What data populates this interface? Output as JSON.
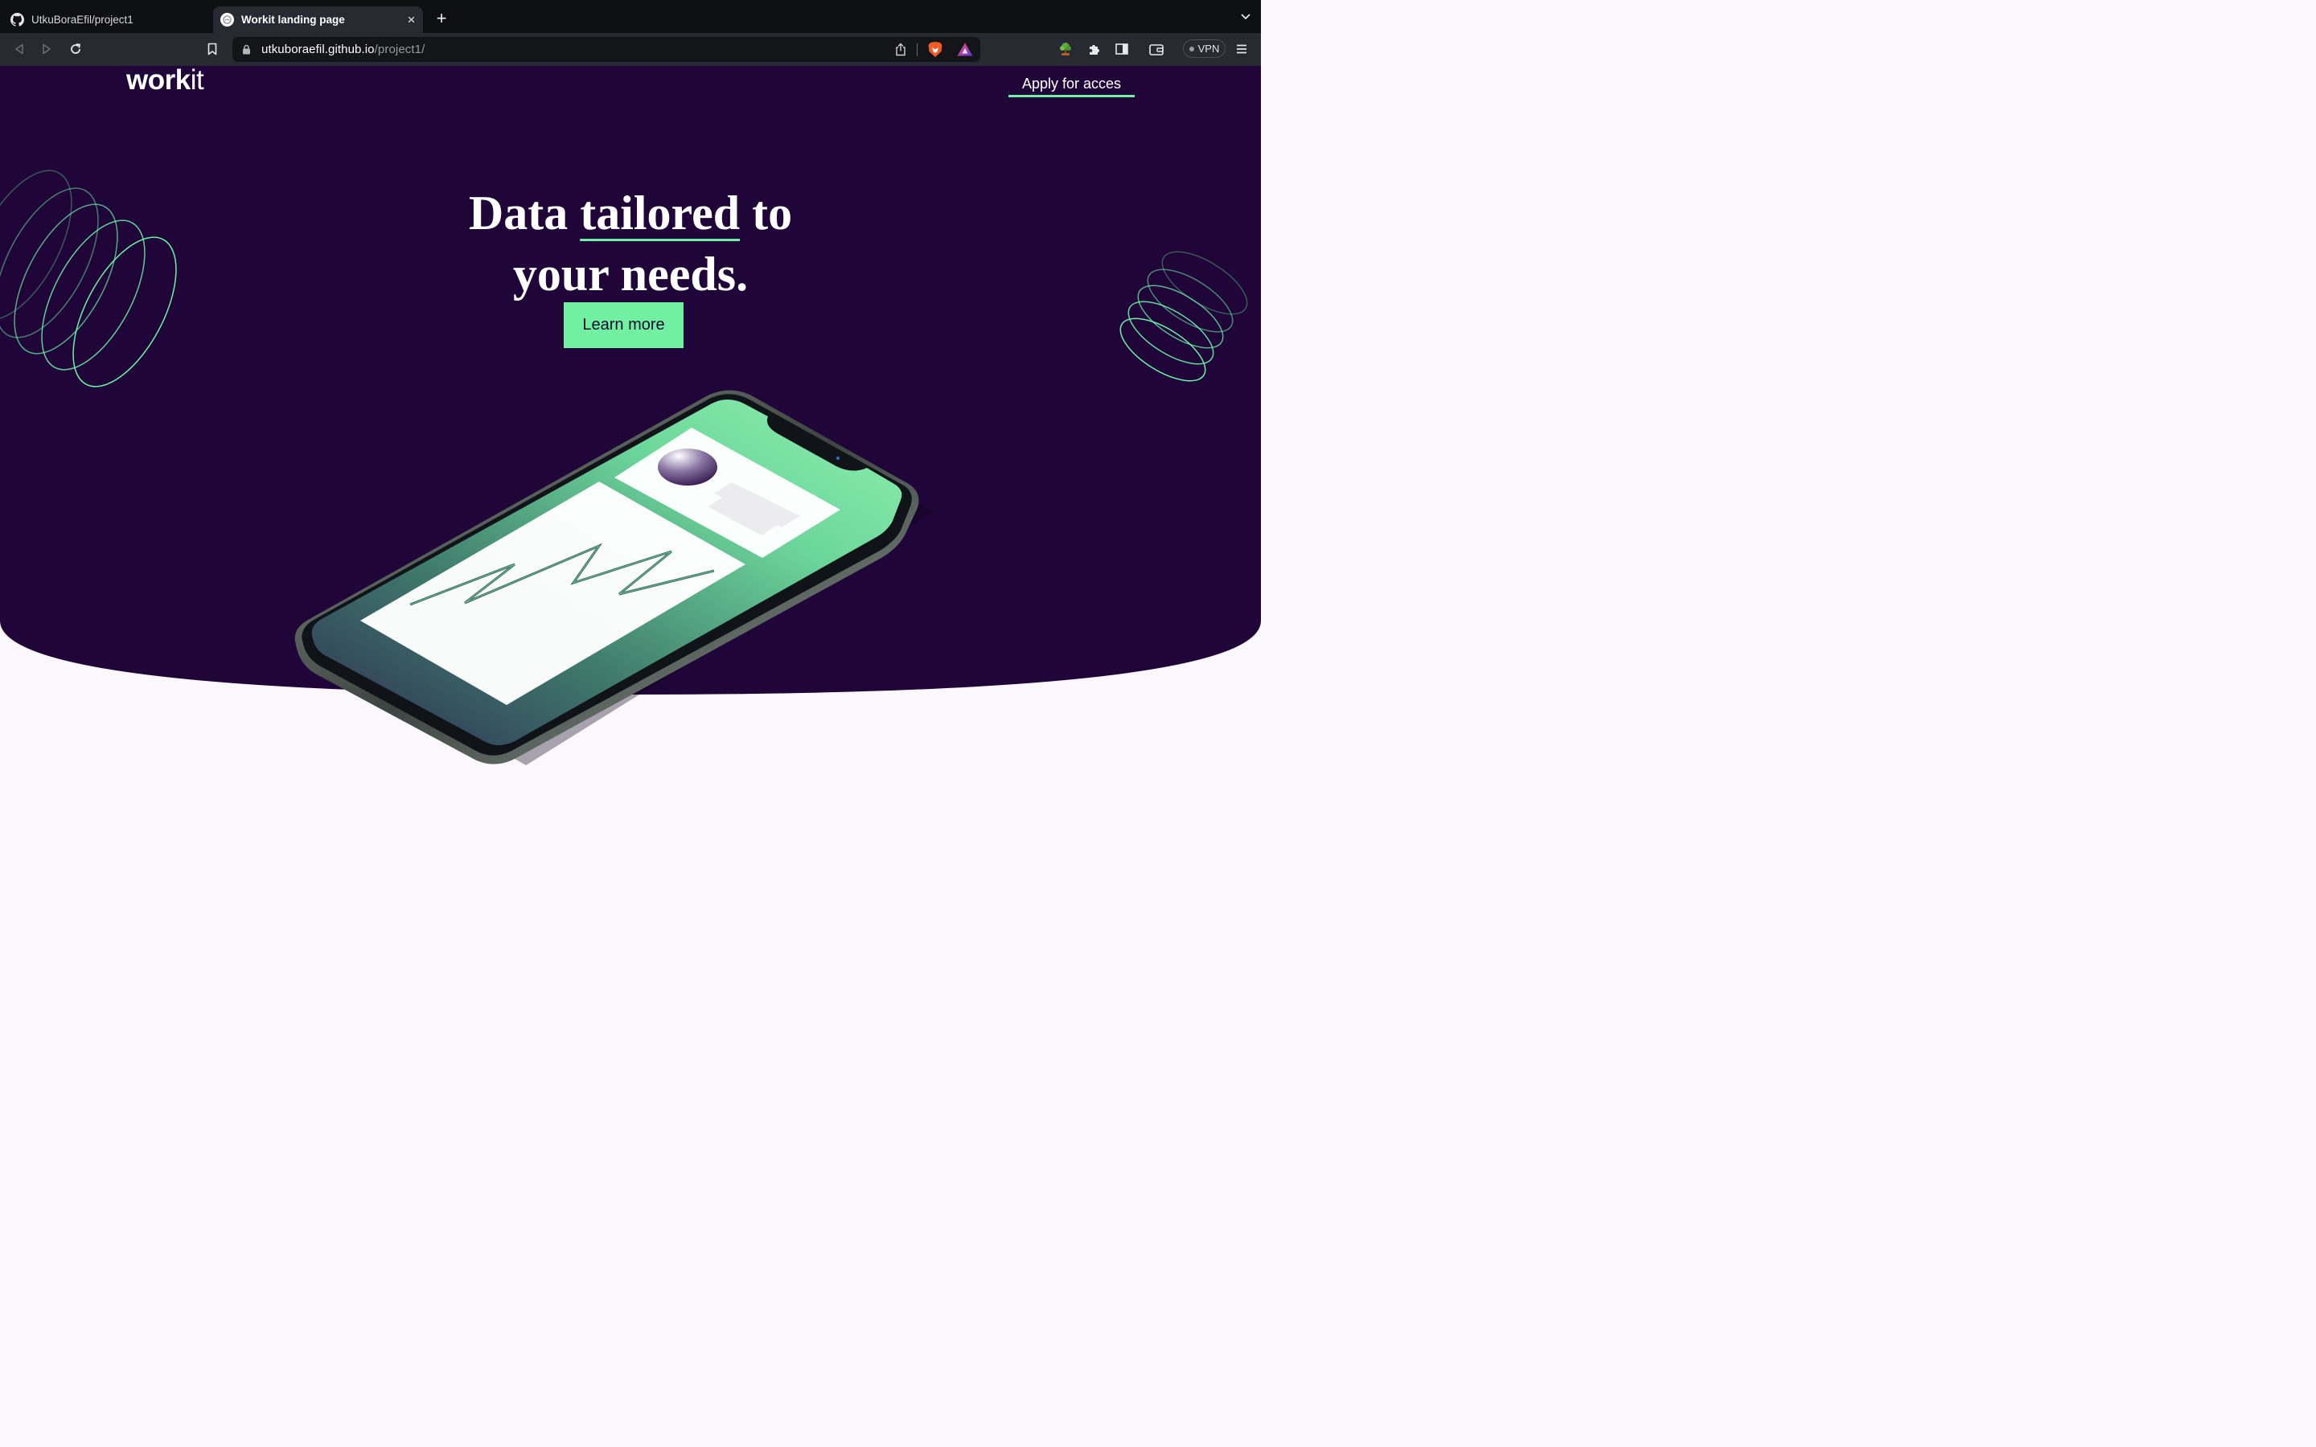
{
  "browser": {
    "tabs": [
      {
        "title": "UtkuBoraEfil/project1",
        "active": false,
        "icon": "github-icon"
      },
      {
        "title": "Workit landing page",
        "active": true,
        "icon": "globe-icon"
      }
    ],
    "url": {
      "host": "utkuboraefil.github.io",
      "path": "/project1/"
    },
    "vpn_label": "VPN"
  },
  "page": {
    "logo": {
      "bold": "work",
      "light": "it"
    },
    "nav": {
      "apply_label": "Apply for acces"
    },
    "hero": {
      "headline_part1": "Data ",
      "headline_underlined": "tailored",
      "headline_part2": " to",
      "headline_line2": "your needs.",
      "cta_label": "Learn more"
    },
    "colors": {
      "hero_background": "#200638",
      "accent": "#72f0a2",
      "page_background": "#faf7fd"
    }
  }
}
